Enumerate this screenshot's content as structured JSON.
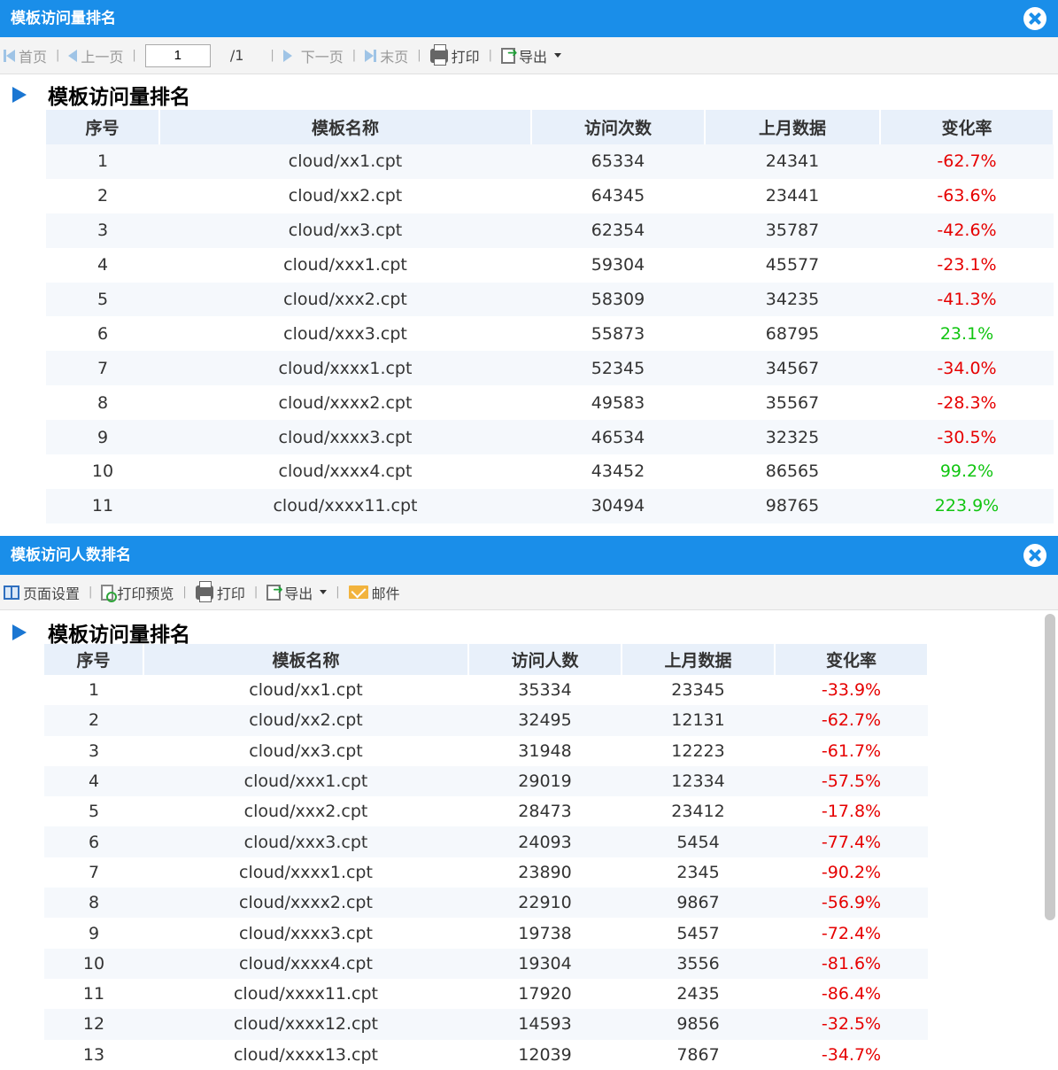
{
  "panel1": {
    "title": "模板访问量排名",
    "toolbar": {
      "first": "首页",
      "prev": "上一页",
      "page_value": "1",
      "page_total": "/1",
      "next": "下一页",
      "last": "末页",
      "print": "打印",
      "export": "导出"
    },
    "report_title": "模板访问量排名",
    "headers": [
      "序号",
      "模板名称",
      "访问次数",
      "上月数据",
      "变化率"
    ],
    "rows": [
      [
        "1",
        "cloud/xx1.cpt",
        "65334",
        "24341",
        "-62.7%"
      ],
      [
        "2",
        "cloud/xx2.cpt",
        "64345",
        "23441",
        "-63.6%"
      ],
      [
        "3",
        "cloud/xx3.cpt",
        "62354",
        "35787",
        "-42.6%"
      ],
      [
        "4",
        "cloud/xxx1.cpt",
        "59304",
        "45577",
        "-23.1%"
      ],
      [
        "5",
        "cloud/xxx2.cpt",
        "58309",
        "34235",
        "-41.3%"
      ],
      [
        "6",
        "cloud/xxx3.cpt",
        "55873",
        "68795",
        "23.1%"
      ],
      [
        "7",
        "cloud/xxxx1.cpt",
        "52345",
        "34567",
        "-34.0%"
      ],
      [
        "8",
        "cloud/xxxx2.cpt",
        "49583",
        "35567",
        "-28.3%"
      ],
      [
        "9",
        "cloud/xxxx3.cpt",
        "46534",
        "32325",
        "-30.5%"
      ],
      [
        "10",
        "cloud/xxxx4.cpt",
        "43452",
        "86565",
        "99.2%"
      ],
      [
        "11",
        "cloud/xxxx11.cpt",
        "30494",
        "98765",
        "223.9%"
      ]
    ]
  },
  "panel2": {
    "title": "模板访问人数排名",
    "toolbar": {
      "page_setup": "页面设置",
      "print_preview": "打印预览",
      "print": "打印",
      "export": "导出",
      "mail": "邮件"
    },
    "report_title": "模板访问量排名",
    "headers": [
      "序号",
      "模板名称",
      "访问人数",
      "上月数据",
      "变化率"
    ],
    "rows": [
      [
        "1",
        "cloud/xx1.cpt",
        "35334",
        "23345",
        "-33.9%"
      ],
      [
        "2",
        "cloud/xx2.cpt",
        "32495",
        "12131",
        "-62.7%"
      ],
      [
        "3",
        "cloud/xx3.cpt",
        "31948",
        "12223",
        "-61.7%"
      ],
      [
        "4",
        "cloud/xxx1.cpt",
        "29019",
        "12334",
        "-57.5%"
      ],
      [
        "5",
        "cloud/xxx2.cpt",
        "28473",
        "23412",
        "-17.8%"
      ],
      [
        "6",
        "cloud/xxx3.cpt",
        "24093",
        "5454",
        "-77.4%"
      ],
      [
        "7",
        "cloud/xxxx1.cpt",
        "23890",
        "2345",
        "-90.2%"
      ],
      [
        "8",
        "cloud/xxxx2.cpt",
        "22910",
        "9867",
        "-56.9%"
      ],
      [
        "9",
        "cloud/xxxx3.cpt",
        "19738",
        "5457",
        "-72.4%"
      ],
      [
        "10",
        "cloud/xxxx4.cpt",
        "19304",
        "3556",
        "-81.6%"
      ],
      [
        "11",
        "cloud/xxxx11.cpt",
        "17920",
        "2435",
        "-86.4%"
      ],
      [
        "12",
        "cloud/xxxx12.cpt",
        "14593",
        "9856",
        "-32.5%"
      ],
      [
        "13",
        "cloud/xxxx13.cpt",
        "12039",
        "7867",
        "-34.7%"
      ]
    ]
  },
  "colors": {
    "titlebar": "#1a8ee9",
    "header_bg": "#e8f0fa",
    "negative": "#e60000",
    "positive": "#11c511"
  }
}
